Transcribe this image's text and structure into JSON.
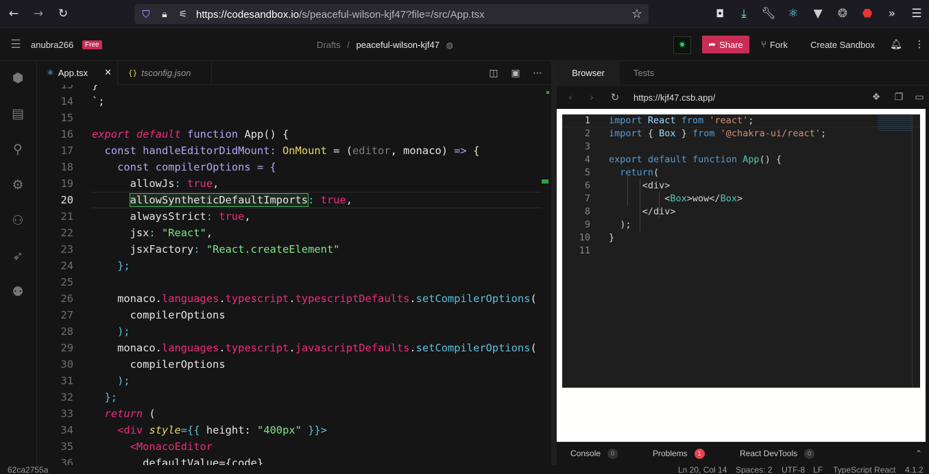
{
  "browser": {
    "url": "https://codesandbox.io/s/peaceful-wilson-kjf47?file=/src/App.tsx",
    "url_host": "https://codesandbox.io",
    "url_path": "/s/peaceful-wilson-kjf47?file=/src/App.tsx"
  },
  "header": {
    "username": "anubra266",
    "plan_badge": "Free",
    "breadcrumb_parent": "Drafts",
    "breadcrumb_separator": "/",
    "sandbox_name": "peaceful-wilson-kjf47",
    "share_label": "Share",
    "fork_label": "Fork",
    "create_label": "Create Sandbox"
  },
  "editor_tabs": [
    {
      "label": "App.tsx",
      "icon": "react-icon",
      "active": true
    },
    {
      "label": "tsconfig.json",
      "icon": "json-icon",
      "active": false
    }
  ],
  "editor": {
    "lines": [
      {
        "n": "13",
        "code": [
          {
            "t": "}",
            "c": "#e5e5e5"
          }
        ]
      },
      {
        "n": "14",
        "code": [
          {
            "t": "`;",
            "c": "#e5e5e5"
          }
        ]
      },
      {
        "n": "15",
        "code": []
      },
      {
        "n": "16",
        "code": [
          {
            "t": "export",
            "c": "#ef2c7c",
            "i": true
          },
          {
            "t": " ",
            "c": "#e5e5e5"
          },
          {
            "t": "default",
            "c": "#ef2c7c",
            "i": true
          },
          {
            "t": " ",
            "c": "#e5e5e5"
          },
          {
            "t": "function",
            "c": "#b3a7f2"
          },
          {
            "t": " App() {",
            "c": "#e5e5e5"
          }
        ]
      },
      {
        "n": "17",
        "code": [
          {
            "t": "  ",
            "c": "#e5e5e5"
          },
          {
            "t": "const",
            "c": "#b3a7f2"
          },
          {
            "t": " handleEditorDidMount: ",
            "c": "#b3a7f2"
          },
          {
            "t": "OnMount",
            "c": "#e8d76a"
          },
          {
            "t": " = (",
            "c": "#e5e5e5"
          },
          {
            "t": "editor",
            "c": "#7e7e7e"
          },
          {
            "t": ", ",
            "c": "#e5e5e5"
          },
          {
            "t": "monaco",
            "c": "#e5e5e5"
          },
          {
            "t": ") ",
            "c": "#e5e5e5"
          },
          {
            "t": "=>",
            "c": "#b3a7f2"
          },
          {
            "t": " {",
            "c": "#e5e5e5"
          }
        ]
      },
      {
        "n": "18",
        "code": [
          {
            "t": "    ",
            "c": "#e5e5e5"
          },
          {
            "t": "const",
            "c": "#b3a7f2"
          },
          {
            "t": " compilerOptions = {",
            "c": "#b3a7f2"
          }
        ]
      },
      {
        "n": "19",
        "code": [
          {
            "t": "      allowJs",
            "c": "#e5e5e5"
          },
          {
            "t": ": ",
            "c": "#5bc0de"
          },
          {
            "t": "true",
            "c": "#ef2c7c"
          },
          {
            "t": ",",
            "c": "#e5e5e5"
          }
        ]
      },
      {
        "n": "20",
        "highlight": true,
        "code": [
          {
            "t": "      ",
            "c": "#e5e5e5"
          },
          {
            "t": "allowSyntheticDefaultImports",
            "c": "#e5e5e5",
            "box": true
          },
          {
            "t": ": ",
            "c": "#5bc0de"
          },
          {
            "t": "true",
            "c": "#ef2c7c"
          },
          {
            "t": ",",
            "c": "#e5e5e5"
          }
        ]
      },
      {
        "n": "21",
        "code": [
          {
            "t": "      alwaysStrict",
            "c": "#e5e5e5"
          },
          {
            "t": ": ",
            "c": "#5bc0de"
          },
          {
            "t": "true",
            "c": "#ef2c7c"
          },
          {
            "t": ",",
            "c": "#e5e5e5"
          }
        ]
      },
      {
        "n": "22",
        "code": [
          {
            "t": "      jsx",
            "c": "#e5e5e5"
          },
          {
            "t": ": ",
            "c": "#5bc0de"
          },
          {
            "t": "\"React\"",
            "c": "#7ee787"
          },
          {
            "t": ",",
            "c": "#e5e5e5"
          }
        ]
      },
      {
        "n": "23",
        "code": [
          {
            "t": "      jsxFactory",
            "c": "#e5e5e5"
          },
          {
            "t": ": ",
            "c": "#5bc0de"
          },
          {
            "t": "\"React.createElement\"",
            "c": "#7ee787"
          }
        ]
      },
      {
        "n": "24",
        "code": [
          {
            "t": "    };",
            "c": "#5bc0de"
          }
        ]
      },
      {
        "n": "25",
        "code": []
      },
      {
        "n": "26",
        "code": [
          {
            "t": "    monaco",
            "c": "#e5e5e5"
          },
          {
            "t": ".",
            "c": "#e5e5e5"
          },
          {
            "t": "languages",
            "c": "#ef2c7c"
          },
          {
            "t": ".",
            "c": "#e5e5e5"
          },
          {
            "t": "typescript",
            "c": "#ef2c7c"
          },
          {
            "t": ".",
            "c": "#e5e5e5"
          },
          {
            "t": "typescriptDefaults",
            "c": "#ef2c7c"
          },
          {
            "t": ".",
            "c": "#e5e5e5"
          },
          {
            "t": "setCompilerOptions",
            "c": "#5bc0de"
          },
          {
            "t": "(",
            "c": "#e5e5e5"
          }
        ]
      },
      {
        "n": "27",
        "code": [
          {
            "t": "      compilerOptions",
            "c": "#e5e5e5"
          }
        ]
      },
      {
        "n": "28",
        "code": [
          {
            "t": "    );",
            "c": "#5bc0de"
          }
        ]
      },
      {
        "n": "29",
        "code": [
          {
            "t": "    monaco",
            "c": "#e5e5e5"
          },
          {
            "t": ".",
            "c": "#e5e5e5"
          },
          {
            "t": "languages",
            "c": "#ef2c7c"
          },
          {
            "t": ".",
            "c": "#e5e5e5"
          },
          {
            "t": "typescript",
            "c": "#ef2c7c"
          },
          {
            "t": ".",
            "c": "#e5e5e5"
          },
          {
            "t": "javascriptDefaults",
            "c": "#ef2c7c"
          },
          {
            "t": ".",
            "c": "#e5e5e5"
          },
          {
            "t": "setCompilerOptions",
            "c": "#5bc0de"
          },
          {
            "t": "(",
            "c": "#e5e5e5"
          }
        ]
      },
      {
        "n": "30",
        "code": [
          {
            "t": "      compilerOptions",
            "c": "#e5e5e5"
          }
        ]
      },
      {
        "n": "31",
        "code": [
          {
            "t": "    );",
            "c": "#5bc0de"
          }
        ]
      },
      {
        "n": "32",
        "code": [
          {
            "t": "  };",
            "c": "#5bc0de"
          }
        ]
      },
      {
        "n": "33",
        "code": [
          {
            "t": "  ",
            "c": "#e5e5e5"
          },
          {
            "t": "return",
            "c": "#ef2c7c",
            "i": true
          },
          {
            "t": " (",
            "c": "#e5e5e5"
          }
        ]
      },
      {
        "n": "34",
        "code": [
          {
            "t": "    ",
            "c": "#e5e5e5"
          },
          {
            "t": "<div",
            "c": "#ef2c7c"
          },
          {
            "t": " ",
            "c": "#e5e5e5"
          },
          {
            "t": "style",
            "c": "#e8d76a",
            "i": true
          },
          {
            "t": "={{",
            "c": "#5bc0de"
          },
          {
            "t": " height: ",
            "c": "#e5e5e5"
          },
          {
            "t": "\"400px\"",
            "c": "#7ee787"
          },
          {
            "t": " }}>",
            "c": "#5bc0de"
          }
        ]
      },
      {
        "n": "35",
        "code": [
          {
            "t": "      ",
            "c": "#e5e5e5"
          },
          {
            "t": "<MonacoEditor",
            "c": "#ef2c7c"
          }
        ]
      },
      {
        "n": "36",
        "code": [
          {
            "t": "        defaultValue={code}",
            "c": "#e5e5e5"
          }
        ]
      }
    ]
  },
  "preview": {
    "tab_browser": "Browser",
    "tab_tests": "Tests",
    "address": "https://kjf47.csb.app/",
    "code_lines": [
      {
        "n": "1",
        "code": [
          {
            "t": "import",
            "c": "#569cd6"
          },
          {
            "t": " React ",
            "c": "#9cdcfe"
          },
          {
            "t": "from",
            "c": "#569cd6"
          },
          {
            "t": " ",
            "c": "#d4d4d4"
          },
          {
            "t": "'react'",
            "c": "#ce9178"
          },
          {
            "t": ";",
            "c": "#d4d4d4"
          }
        ]
      },
      {
        "n": "2",
        "code": [
          {
            "t": "import",
            "c": "#569cd6"
          },
          {
            "t": " { ",
            "c": "#d4d4d4"
          },
          {
            "t": "Box",
            "c": "#9cdcfe"
          },
          {
            "t": " } ",
            "c": "#d4d4d4"
          },
          {
            "t": "from",
            "c": "#569cd6"
          },
          {
            "t": " ",
            "c": "#d4d4d4"
          },
          {
            "t": "'@chakra-ui/react'",
            "c": "#ce9178"
          },
          {
            "t": ";",
            "c": "#d4d4d4"
          }
        ]
      },
      {
        "n": "3",
        "code": []
      },
      {
        "n": "4",
        "code": [
          {
            "t": "export",
            "c": "#569cd6"
          },
          {
            "t": " ",
            "c": "#d4d4d4"
          },
          {
            "t": "default",
            "c": "#569cd6"
          },
          {
            "t": " ",
            "c": "#d4d4d4"
          },
          {
            "t": "function",
            "c": "#569cd6"
          },
          {
            "t": " ",
            "c": "#d4d4d4"
          },
          {
            "t": "App",
            "c": "#4ec9b0"
          },
          {
            "t": "() {",
            "c": "#d4d4d4"
          }
        ]
      },
      {
        "n": "5",
        "code": [
          {
            "t": "  ",
            "c": "#d4d4d4"
          },
          {
            "t": "return",
            "c": "#569cd6"
          },
          {
            "t": "(",
            "c": "#d4d4d4"
          }
        ]
      },
      {
        "n": "6",
        "code": [
          {
            "t": "      <div>",
            "c": "#d4d4d4"
          }
        ]
      },
      {
        "n": "7",
        "code": [
          {
            "t": "          <",
            "c": "#d4d4d4"
          },
          {
            "t": "Box",
            "c": "#4ec9b0"
          },
          {
            "t": ">wow</",
            "c": "#d4d4d4"
          },
          {
            "t": "Box",
            "c": "#4ec9b0"
          },
          {
            "t": ">",
            "c": "#d4d4d4"
          }
        ]
      },
      {
        "n": "8",
        "code": [
          {
            "t": "      </div>",
            "c": "#d4d4d4"
          }
        ]
      },
      {
        "n": "9",
        "code": [
          {
            "t": "  );",
            "c": "#d4d4d4"
          }
        ]
      },
      {
        "n": "10",
        "code": [
          {
            "t": "}",
            "c": "#d4d4d4"
          }
        ]
      },
      {
        "n": "11",
        "code": []
      }
    ]
  },
  "bottom_panel": {
    "console_label": "Console",
    "console_count": "0",
    "problems_label": "Problems",
    "problems_count": "1",
    "devtools_label": "React DevTools",
    "devtools_count": "0"
  },
  "status": {
    "commit": "62ca2755a",
    "cursor": "Ln 20, Col 14",
    "spaces": "Spaces: 2",
    "encoding": "UTF-8",
    "eol": "LF",
    "language": "TypeScript React",
    "version": "4.1.2"
  },
  "colors": {
    "accent_share": "#c82d55",
    "badge_free": "#c82d55",
    "problems_badge": "#e5424f",
    "editor_bg": "#151515",
    "highlight_box": "#4bb462"
  }
}
